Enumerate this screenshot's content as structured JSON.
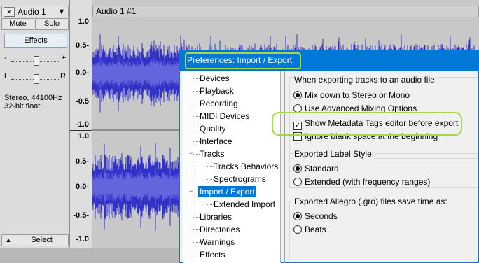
{
  "track": {
    "close_glyph": "×",
    "name": "Audio 1",
    "menu_glyph": "▼",
    "mute_label": "Mute",
    "solo_label": "Solo",
    "effects_label": "Effects",
    "gain_minus": "-",
    "gain_plus": "+",
    "pan_left": "L",
    "pan_right": "R",
    "info_line1": "Stereo, 44100Hz",
    "info_line2": "32-bit float",
    "collapse_glyph": "▲",
    "select_label": "Select"
  },
  "ruler": {
    "upper": [
      "1.0",
      "0.5-",
      "0.0-",
      "-0.5",
      "-1.0"
    ],
    "lower": [
      "1.0",
      "0.5-",
      "0.0-",
      "-0.5-",
      "-1.0"
    ]
  },
  "clip": {
    "title": "Audio 1 #1"
  },
  "colors": {
    "wave": "#3232c8",
    "wave_rms": "#6464dc",
    "highlight": "#a8d84a",
    "titlebar": "#0078d7"
  },
  "dialog": {
    "title": "Preferences: Import / Export",
    "tree": [
      {
        "label": "Devices",
        "selected": false
      },
      {
        "label": "Playback",
        "selected": false
      },
      {
        "label": "Recording",
        "selected": false
      },
      {
        "label": "MIDI Devices",
        "selected": false
      },
      {
        "label": "Quality",
        "selected": false
      },
      {
        "label": "Interface",
        "selected": false
      },
      {
        "label": "Tracks",
        "selected": false
      },
      {
        "label": "Tracks Behaviors",
        "selected": false
      },
      {
        "label": "Spectrograms",
        "selected": false
      },
      {
        "label": "Import / Export",
        "selected": true
      },
      {
        "label": "Extended Import",
        "selected": false
      },
      {
        "label": "Libraries",
        "selected": false
      },
      {
        "label": "Directories",
        "selected": false
      },
      {
        "label": "Warnings",
        "selected": false
      },
      {
        "label": "Effects",
        "selected": false
      }
    ],
    "expander_open": "−",
    "export_group": {
      "label": "When exporting tracks to an audio file",
      "mix_down": "Mix down to Stereo or Mono",
      "mix_down_selected": true,
      "advanced": "Use Advanced Mixing Options",
      "advanced_selected": false,
      "show_metadata": "Show Metadata Tags editor before export",
      "show_metadata_checked": true,
      "ignore_blank": "Ignore blank space at the beginning",
      "ignore_blank_checked": false
    },
    "label_style_group": {
      "label": "Exported Label Style:",
      "standard": "Standard",
      "standard_selected": true,
      "extended": "Extended (with frequency ranges)",
      "extended_selected": false
    },
    "allegro_group": {
      "label": "Exported Allegro (.gro) files save time as:",
      "seconds": "Seconds",
      "seconds_selected": true,
      "beats": "Beats",
      "beats_selected": false
    },
    "check_glyph": "✓"
  }
}
